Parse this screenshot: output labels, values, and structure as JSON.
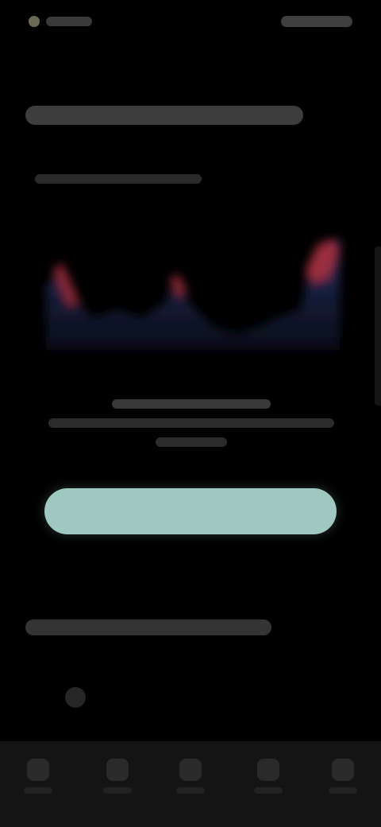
{
  "status_bar": {
    "time": "",
    "icons": [
      "signal-icon",
      "wifi-icon",
      "battery-icon"
    ]
  },
  "page": {
    "title": "",
    "subtitle": ""
  },
  "chart_area": {
    "caption_lines": [
      "",
      "",
      ""
    ],
    "colors": {
      "accent_red": "#b0303f",
      "fill_blue": "#1b2448"
    }
  },
  "primary_button": {
    "label": "",
    "color": "#9fc9c0"
  },
  "section": {
    "title": ""
  },
  "bottom_nav": {
    "items": [
      {
        "icon": "home-icon",
        "label": ""
      },
      {
        "icon": "list-icon",
        "label": ""
      },
      {
        "icon": "chart-icon",
        "label": ""
      },
      {
        "icon": "bell-icon",
        "label": ""
      },
      {
        "icon": "settings-icon",
        "label": ""
      }
    ]
  }
}
